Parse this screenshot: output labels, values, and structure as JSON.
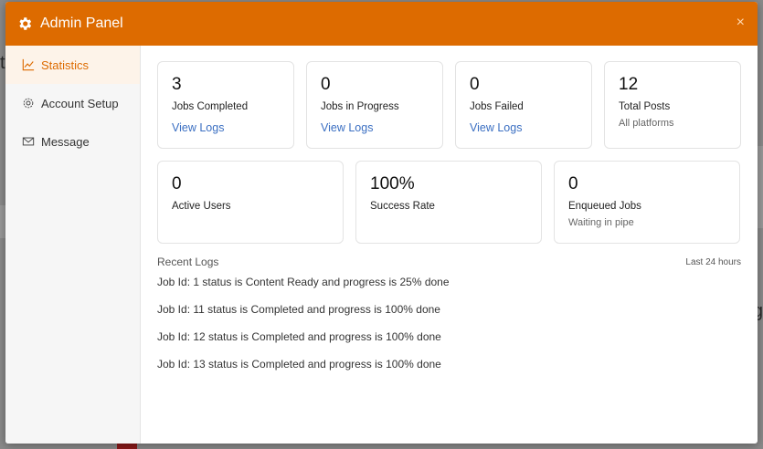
{
  "modal": {
    "title": "Admin Panel",
    "close_label": "×",
    "header_color": "#dd6b00"
  },
  "sidebar": {
    "items": [
      {
        "label": "Statistics",
        "icon": "chart-line-icon",
        "active": true
      },
      {
        "label": "Account Setup",
        "icon": "gear-icon",
        "active": false
      },
      {
        "label": "Message",
        "icon": "envelope-icon",
        "active": false
      }
    ]
  },
  "stats": {
    "jobs_completed": {
      "value": "3",
      "label": "Jobs Completed",
      "link": "View Logs"
    },
    "jobs_in_progress": {
      "value": "0",
      "label": "Jobs in Progress",
      "link": "View Logs"
    },
    "jobs_failed": {
      "value": "0",
      "label": "Jobs Failed",
      "link": "View Logs"
    },
    "total_posts": {
      "value": "12",
      "label": "Total Posts",
      "sub": "All platforms"
    },
    "active_users": {
      "value": "0",
      "label": "Active Users"
    },
    "success_rate": {
      "value": "100%",
      "label": "Success Rate"
    },
    "enqueued_jobs": {
      "value": "0",
      "label": "Enqueued Jobs",
      "sub": "Waiting in pipe"
    }
  },
  "logs": {
    "title": "Recent Logs",
    "range": "Last 24 hours",
    "lines": [
      "Job Id: 1 status is Content Ready and progress is 25% done",
      "Job Id: 11 status is Completed and progress is 100% done",
      "Job Id: 12 status is Completed and progress is 100% done",
      "Job Id: 13 status is Completed and progress is 100% done"
    ]
  },
  "background": {
    "left_glyph": "t",
    "right_glyph": "g"
  }
}
